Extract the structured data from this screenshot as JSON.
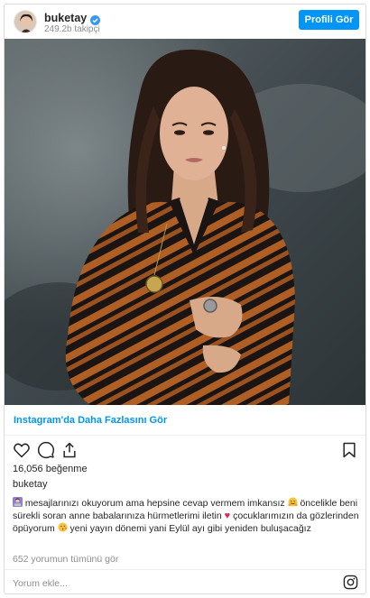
{
  "header": {
    "username": "buketay",
    "followers": "249.2b takipçi",
    "profile_button": "Profili Gör",
    "verified": true
  },
  "photo": {
    "description_icon": "post-photo"
  },
  "more_link": "Instagram'da Daha Fazlasını Gör",
  "actions": {
    "like_icon": "heart-icon",
    "comment_icon": "comment-icon",
    "share_icon": "share-icon",
    "save_icon": "bookmark-icon"
  },
  "likes": "16,056 beğenme",
  "post_username": "buketay",
  "caption": {
    "part1": " mesajlarınızı okuyorum ama hepsine cevap vermem imkansız ",
    "part2": " öncelikle beni sürekli soran anne babalarınıza hürmetlerimi iletin ",
    "part3": " çocuklarımızın da gözlerinden öpüyorum ",
    "part4": " yeni yayın dönemi yani Eylül ayı gibi yeniden buluşacağız"
  },
  "view_comments": "652 yorumun tümünü gör",
  "comment_input": {
    "placeholder": "Yorum ekle..."
  },
  "colors": {
    "accent": "#0095f6",
    "text": "#262626",
    "muted": "#8e8e8e",
    "heart": "#e0245e"
  }
}
